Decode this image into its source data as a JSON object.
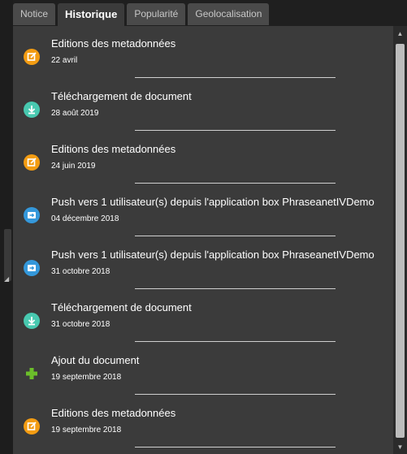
{
  "tabs": [
    {
      "label": "Notice",
      "active": false
    },
    {
      "label": "Historique",
      "active": true
    },
    {
      "label": "Popularité",
      "active": false
    },
    {
      "label": "Geolocalisation",
      "active": false
    }
  ],
  "history": [
    {
      "title": "Editions des metadonnées",
      "date": "22 avril",
      "icon": "edit-icon",
      "color": "#f39c12"
    },
    {
      "title": "Téléchargement de document",
      "date": "28 août 2019",
      "icon": "download-icon",
      "color": "#48c9b0"
    },
    {
      "title": "Editions des metadonnées",
      "date": "24 juin 2019",
      "icon": "edit-icon",
      "color": "#f39c12"
    },
    {
      "title": "Push vers 1 utilisateur(s) depuis l'application box PhraseanetIVDemo",
      "date": "04 décembre 2018",
      "icon": "push-icon",
      "color": "#3498db"
    },
    {
      "title": "Push vers 1 utilisateur(s) depuis l'application box PhraseanetIVDemo",
      "date": "31 octobre 2018",
      "icon": "push-icon",
      "color": "#3498db"
    },
    {
      "title": "Téléchargement de document",
      "date": "31 octobre 2018",
      "icon": "download-icon",
      "color": "#48c9b0"
    },
    {
      "title": "Ajout du document",
      "date": "19 septembre 2018",
      "icon": "add-icon",
      "color": "#6bbf2a"
    },
    {
      "title": "Editions des metadonnées",
      "date": "19 septembre 2018",
      "icon": "edit-icon",
      "color": "#f39c12"
    }
  ]
}
